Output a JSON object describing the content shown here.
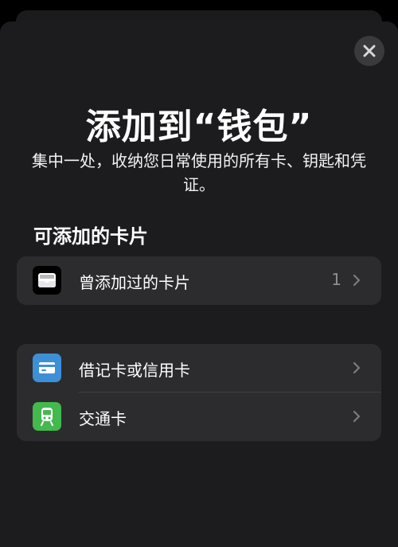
{
  "sheet": {
    "close_icon": "close-icon",
    "title": "添加到“钱包”",
    "subtitle": "集中一处，收纳您日常使用的所有卡、钥匙和凭证。",
    "section_title": "可添加的卡片"
  },
  "rows": [
    {
      "label": "曾添加过的卡片",
      "count": "1",
      "icon": "wallet-icon",
      "icon_color": "#000000"
    },
    {
      "label": "借记卡或信用卡",
      "icon": "credit-card-icon",
      "icon_color": "#3d8fd6"
    },
    {
      "label": "交通卡",
      "icon": "train-icon",
      "icon_color": "#43b94e"
    }
  ],
  "colors": {
    "sheet_bg": "#1c1c1e",
    "group_bg": "#2c2c2e",
    "secondary_text": "#8e8e93"
  }
}
